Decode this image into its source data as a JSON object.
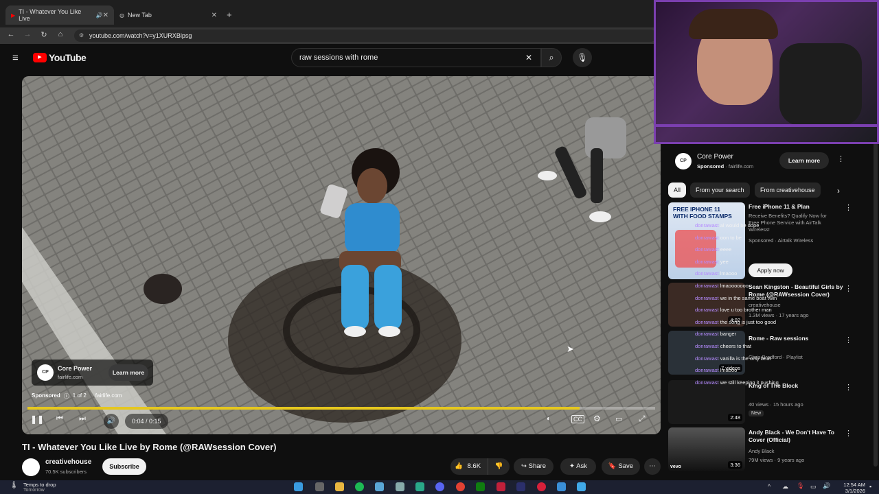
{
  "browser": {
    "tabs": [
      {
        "label": "TI - Whatever You Like Live",
        "active": true
      },
      {
        "label": "New Tab",
        "active": false
      }
    ],
    "url": "youtube.com/watch?v=y1XURXBlpsg"
  },
  "youtube": {
    "logo_text": "YouTube",
    "search_value": "raw sessions with rome"
  },
  "video": {
    "ad": {
      "brand": "Core Power",
      "domain": "fairlife.com",
      "cta": "Learn more",
      "sponsored_label": "Sponsored",
      "count": "1 of 2",
      "site": "fairlife.com"
    },
    "time": "0:04 / 0:15",
    "progress": 0.88,
    "title": "TI - Whatever You Like Live by Rome (@RAWsession Cover)",
    "channel": "creativehouse",
    "subscribers": "70.5K subscribers",
    "subscribe_label": "Subscribe",
    "likes": "8.6K",
    "share_label": "Share",
    "ask_label": "Ask",
    "save_label": "Save"
  },
  "sidebar": {
    "ad": {
      "brand": "Core Power",
      "sponsored": "Sponsored",
      "domain": "fairlife.com",
      "cta": "Learn more"
    },
    "chips": [
      "All",
      "From your search",
      "From creativehouse"
    ],
    "items": [
      {
        "title": "Free iPhone 11 & Plan",
        "desc": "Receive Benefits? Qualify Now for Free Phone Service with AirTalk Wireless!",
        "channel": "Sponsored · Airtalk Wireless",
        "thumb_text": "FREE IPHONE 11 WITH FOOD STAMPS",
        "cta": "Apply now"
      },
      {
        "title": "Sean Kingston - Beautiful Girls by Rome (@RAWsession Cover)",
        "channel": "creativehouse",
        "meta": "1.3M views · 17 years ago",
        "duration": "4:02"
      },
      {
        "title": "Rome - Raw sessions",
        "channel": "Chris Bradford · Playlist",
        "meta": "",
        "duration": "7 videos"
      },
      {
        "title": "King of The Block",
        "channel": "",
        "meta": "40 views · 15 hours ago",
        "badge": "New",
        "duration": "2:48"
      },
      {
        "title": "Andy Black - We Don't Have To Cover (Official)",
        "channel": "Andy Black",
        "meta": "79M views · 9 years ago",
        "duration": "3:36"
      }
    ]
  },
  "chat_overlay": [
    {
      "name": "donrawast",
      "msg": "al would be dope"
    },
    {
      "name": "donrawast",
      "msg": "oon to be"
    },
    {
      "name": "donrawast",
      "msg": "eeee"
    },
    {
      "name": "donrawast",
      "msg": "yee"
    },
    {
      "name": "donrawast",
      "msg": "lmaooo"
    },
    {
      "name": "donrawast",
      "msg": "lmaooooooo"
    },
    {
      "name": "donrawast",
      "msg": "we in the same boat twin"
    },
    {
      "name": "donrawast",
      "msg": "love u too brother man"
    },
    {
      "name": "donrawast",
      "msg": "the song is just too good"
    },
    {
      "name": "donrawast",
      "msg": "banger"
    },
    {
      "name": "donrawast",
      "msg": "cheers to that"
    },
    {
      "name": "donrawast",
      "msg": "vanilla is the only beat"
    },
    {
      "name": "donrawast",
      "msg": "lmaooo"
    },
    {
      "name": "donrawast",
      "msg": "we still keeping it pushing"
    }
  ],
  "taskbar": {
    "weather_title": "Temps to drop",
    "weather_sub": "Tomorrow",
    "time": "12:54 AM",
    "date": "3/1/2026"
  },
  "colors": {
    "progress": "#e5c71f",
    "accent_purple": "#7b3fb0",
    "yt_red": "#ff0000"
  }
}
